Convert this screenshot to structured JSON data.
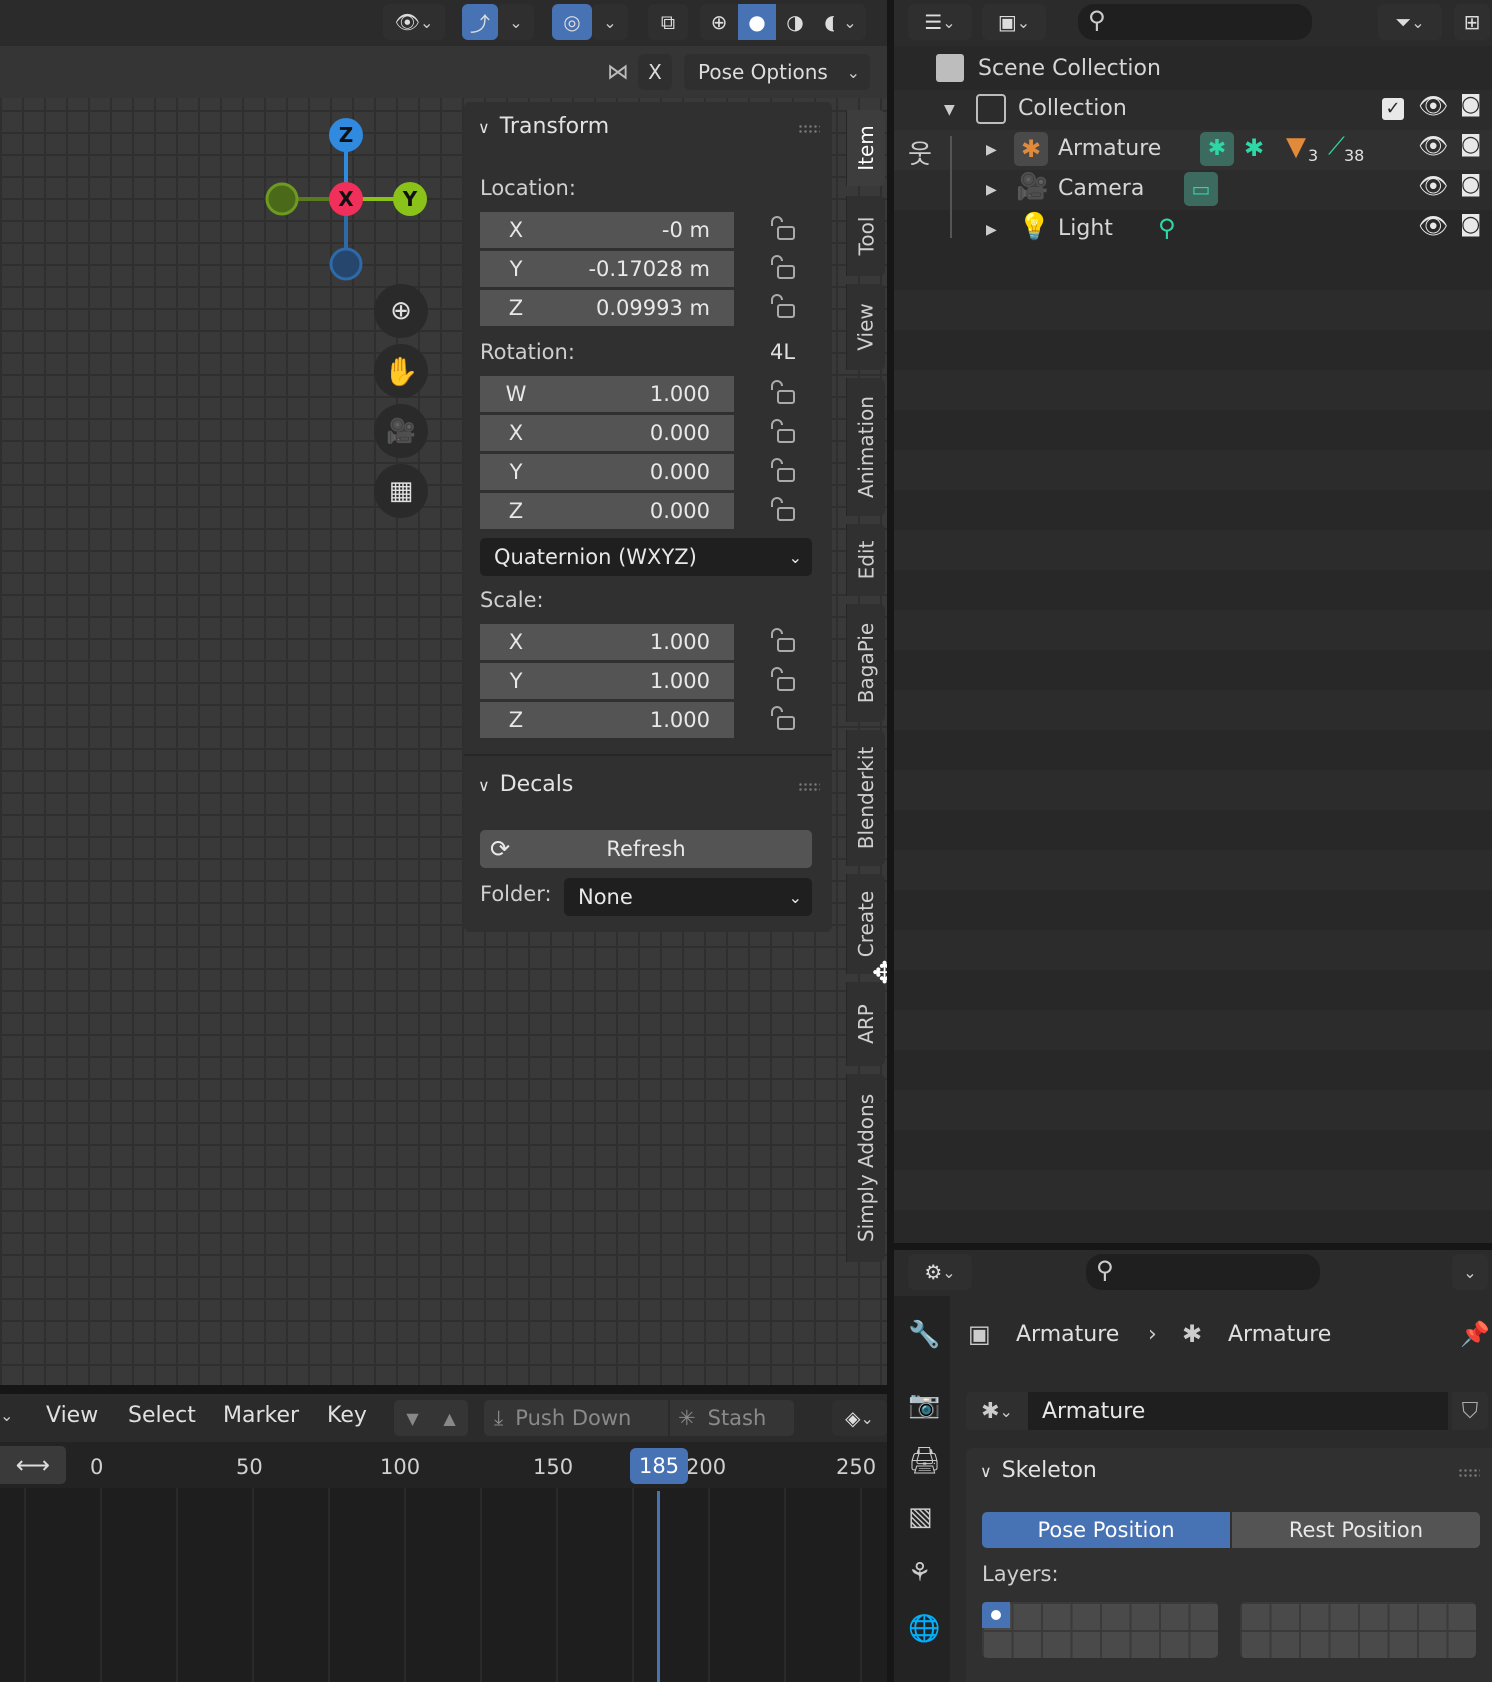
{
  "viewport_header": {
    "pose_options_label": "Pose Options",
    "x_toggle": "X"
  },
  "gizmo": {
    "z": "Z",
    "x": "X",
    "y": "Y"
  },
  "npanel": {
    "transform": {
      "title": "Transform",
      "location_label": "Location:",
      "location": [
        {
          "axis": "X",
          "value": "-0 m"
        },
        {
          "axis": "Y",
          "value": "-0.17028 m"
        },
        {
          "axis": "Z",
          "value": "0.09993 m"
        }
      ],
      "rotation_label": "Rotation:",
      "rotation_mode_short": "4L",
      "rotation": [
        {
          "axis": "W",
          "value": "1.000"
        },
        {
          "axis": "X",
          "value": "0.000"
        },
        {
          "axis": "Y",
          "value": "0.000"
        },
        {
          "axis": "Z",
          "value": "0.000"
        }
      ],
      "rotation_mode": "Quaternion (WXYZ)",
      "scale_label": "Scale:",
      "scale": [
        {
          "axis": "X",
          "value": "1.000"
        },
        {
          "axis": "Y",
          "value": "1.000"
        },
        {
          "axis": "Z",
          "value": "1.000"
        }
      ]
    },
    "decals": {
      "title": "Decals",
      "refresh_label": "Refresh",
      "folder_label": "Folder:",
      "folder_value": "None"
    }
  },
  "tabs": [
    "Item",
    "Tool",
    "View",
    "Animation",
    "Edit",
    "BagaPie",
    "Blenderkit",
    "Create",
    "ARP",
    "Simply Addons"
  ],
  "outliner": {
    "scene_collection": "Scene Collection",
    "collection": "Collection",
    "items": [
      {
        "name": "Armature",
        "badge_mesh_count": "3",
        "badge_bone_count": "38"
      },
      {
        "name": "Camera"
      },
      {
        "name": "Light"
      }
    ]
  },
  "properties": {
    "breadcrumb": [
      "Armature",
      "Armature"
    ],
    "data_name": "Armature",
    "skeleton_title": "Skeleton",
    "pose_position": "Pose Position",
    "rest_position": "Rest Position",
    "layers_label": "Layers:"
  },
  "timeline": {
    "menu": [
      "View",
      "Select",
      "Marker",
      "Key"
    ],
    "push_down": "Push Down",
    "stash": "Stash",
    "current_frame": "185",
    "ticks": [
      "0",
      "50",
      "100",
      "150",
      "200",
      "250"
    ]
  },
  "colors": {
    "accent": "#4772b3",
    "axis_x": "#f0305a",
    "axis_y": "#8ac21a",
    "axis_z": "#2f8ae0",
    "object_orange": "#e08a3a",
    "data_teal": "#2fd6a6"
  }
}
